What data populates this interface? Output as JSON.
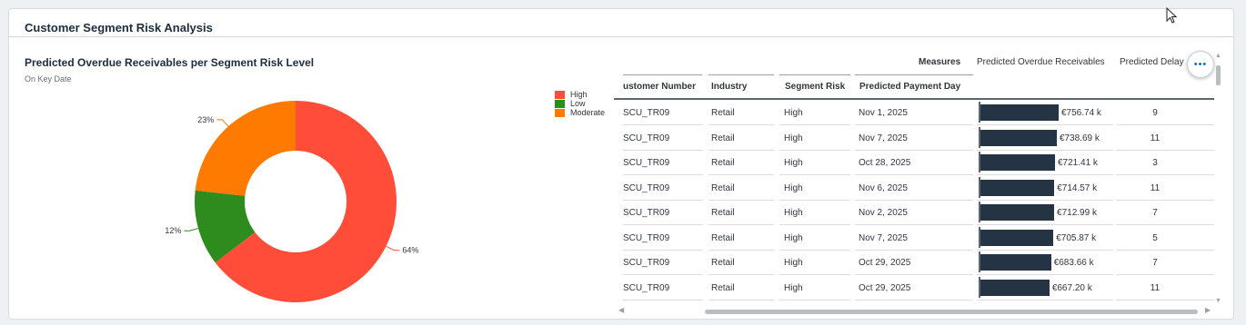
{
  "card": {
    "title": "Customer Segment Risk Analysis"
  },
  "chart": {
    "title": "Predicted Overdue Receivables per Segment Risk Level",
    "subtitle": "On Key Date",
    "legend": [
      {
        "label": "High",
        "color": "#ff4d3a"
      },
      {
        "label": "Low",
        "color": "#2e8b1e"
      },
      {
        "label": "Moderate",
        "color": "#ff7a00"
      }
    ]
  },
  "chart_data": {
    "type": "pie",
    "title": "Predicted Overdue Receivables per Segment Risk Level",
    "subtitle": "On Key Date",
    "donut": true,
    "slices": [
      {
        "label": "High",
        "value": 64,
        "display": "64%",
        "color": "#ff4d3a"
      },
      {
        "label": "Low",
        "value": 12,
        "display": "12%",
        "color": "#2e8b1e"
      },
      {
        "label": "Moderate",
        "value": 23,
        "display": "23%",
        "color": "#ff7a00"
      }
    ],
    "legend_position": "right"
  },
  "table": {
    "measures_label": "Measures",
    "measure_columns": [
      "Predicted Overdue Receivables",
      "Predicted Delay"
    ],
    "headers": [
      "ustomer Number",
      "Industry",
      "Segment Risk",
      "Predicted Payment Day"
    ],
    "bar_max": 756.74,
    "rows": [
      {
        "customer": "SCU_TR09",
        "industry": "Retail",
        "risk": "High",
        "payment_day": "Nov 1, 2025",
        "receivables": 756.74,
        "receivables_label": "€756.74 k",
        "delay": "9"
      },
      {
        "customer": "SCU_TR09",
        "industry": "Retail",
        "risk": "High",
        "payment_day": "Nov 7, 2025",
        "receivables": 738.69,
        "receivables_label": "€738.69 k",
        "delay": "11"
      },
      {
        "customer": "SCU_TR09",
        "industry": "Retail",
        "risk": "High",
        "payment_day": "Oct 28, 2025",
        "receivables": 721.41,
        "receivables_label": "€721.41 k",
        "delay": "3"
      },
      {
        "customer": "SCU_TR09",
        "industry": "Retail",
        "risk": "High",
        "payment_day": "Nov 6, 2025",
        "receivables": 714.57,
        "receivables_label": "€714.57 k",
        "delay": "11"
      },
      {
        "customer": "SCU_TR09",
        "industry": "Retail",
        "risk": "High",
        "payment_day": "Nov 2, 2025",
        "receivables": 712.99,
        "receivables_label": "€712.99 k",
        "delay": "7"
      },
      {
        "customer": "SCU_TR09",
        "industry": "Retail",
        "risk": "High",
        "payment_day": "Nov 7, 2025",
        "receivables": 705.87,
        "receivables_label": "€705.87 k",
        "delay": "5"
      },
      {
        "customer": "SCU_TR09",
        "industry": "Retail",
        "risk": "High",
        "payment_day": "Oct 29, 2025",
        "receivables": 683.66,
        "receivables_label": "€683.66 k",
        "delay": "7"
      },
      {
        "customer": "SCU_TR09",
        "industry": "Retail",
        "risk": "High",
        "payment_day": "Oct 29, 2025",
        "receivables": 667.2,
        "receivables_label": "€667.20 k",
        "delay": "11"
      }
    ]
  },
  "more_button": {
    "icon": "more-icon",
    "label": "•••"
  }
}
